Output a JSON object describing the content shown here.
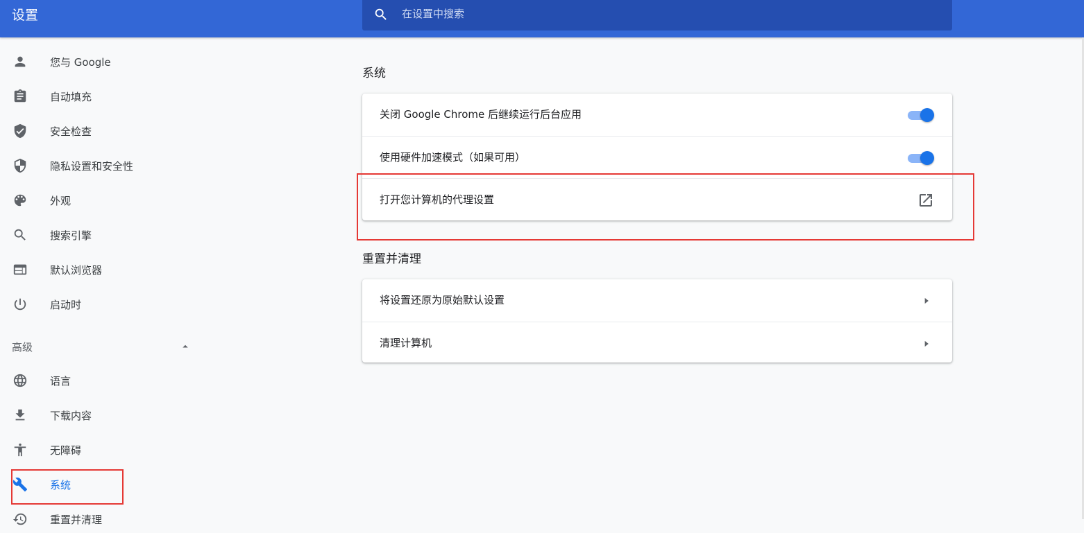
{
  "header": {
    "title": "设置",
    "search_placeholder": "在设置中搜索",
    "search_value": ""
  },
  "sidebar": {
    "items": [
      {
        "label": "您与 Google",
        "icon": "person-icon"
      },
      {
        "label": "自动填充",
        "icon": "clipboard-icon"
      },
      {
        "label": "安全检查",
        "icon": "shield-check-icon"
      },
      {
        "label": "隐私设置和安全性",
        "icon": "shield-icon"
      },
      {
        "label": "外观",
        "icon": "palette-icon"
      },
      {
        "label": "搜索引擎",
        "icon": "search-icon"
      },
      {
        "label": "默认浏览器",
        "icon": "browser-icon"
      },
      {
        "label": "启动时",
        "icon": "power-icon"
      }
    ],
    "advanced": {
      "label": "高级",
      "items": [
        {
          "label": "语言",
          "icon": "globe-icon"
        },
        {
          "label": "下载内容",
          "icon": "download-icon"
        },
        {
          "label": "无障碍",
          "icon": "accessibility-icon"
        },
        {
          "label": "系统",
          "icon": "wrench-icon",
          "active": true
        },
        {
          "label": "重置并清理",
          "icon": "reset-icon"
        }
      ]
    }
  },
  "main": {
    "system": {
      "title": "系统",
      "rows": [
        {
          "label": "关闭 Google Chrome 后继续运行后台应用",
          "control": "toggle",
          "checked": true
        },
        {
          "label": "使用硬件加速模式（如果可用）",
          "control": "toggle",
          "checked": true
        },
        {
          "label": "打开您计算机的代理设置",
          "control": "external-link"
        }
      ]
    },
    "reset": {
      "title": "重置并清理",
      "rows": [
        {
          "label": "将设置还原为原始默认设置",
          "control": "arrow"
        },
        {
          "label": "清理计算机",
          "control": "arrow"
        }
      ]
    }
  },
  "colors": {
    "header": "#3367d6",
    "search_box": "#254eb0",
    "accent": "#1a73e8",
    "toggle_track": "#8ab4f8",
    "highlight": "#e53935"
  }
}
